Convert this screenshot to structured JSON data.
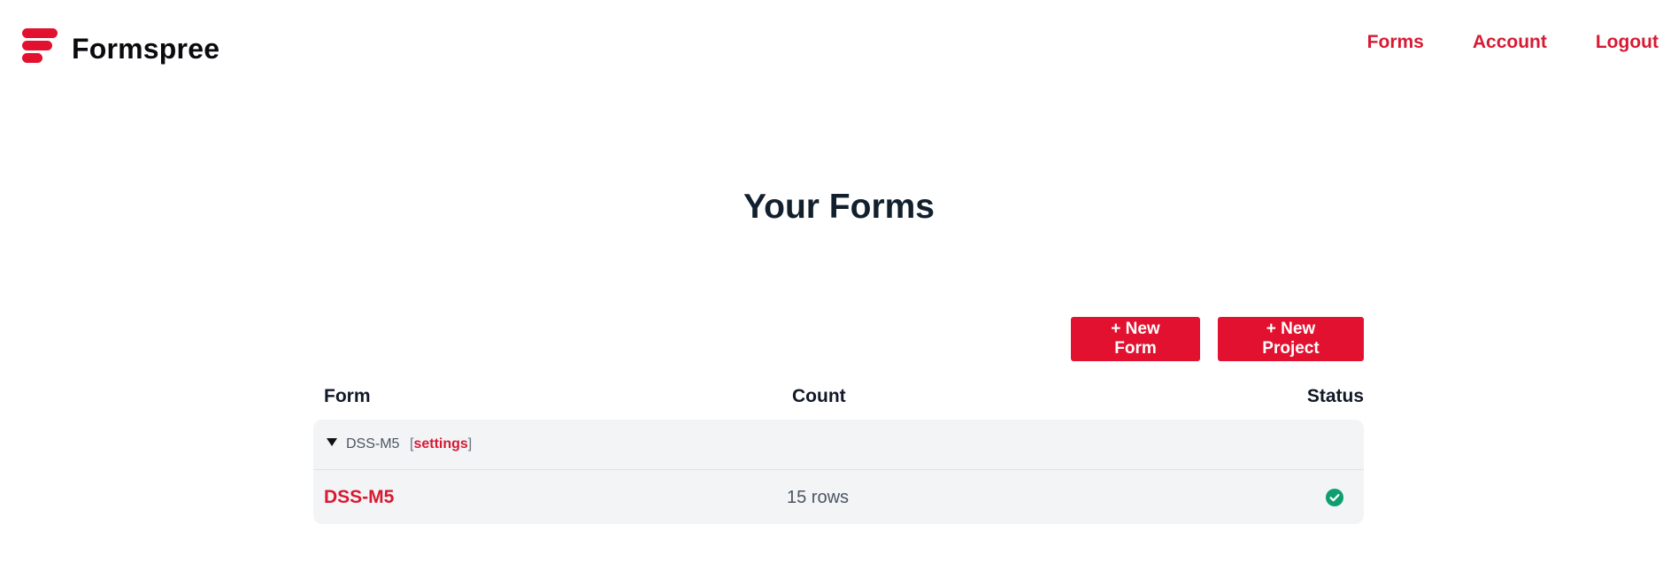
{
  "brand": {
    "name": "Formspree",
    "color": "#e1112f"
  },
  "nav": {
    "forms": "Forms",
    "account": "Account",
    "logout": "Logout"
  },
  "page": {
    "title": "Your Forms"
  },
  "actions": {
    "new_form": "+ New Form",
    "new_project": "+ New Project"
  },
  "table": {
    "headers": {
      "form": "Form",
      "count": "Count",
      "status": "Status"
    },
    "project": {
      "name": "DSS-M5",
      "settings_open": "[",
      "settings_label": "settings",
      "settings_close": "]",
      "expanded": true
    },
    "rows": [
      {
        "name": "DSS-M5",
        "count": "15 rows",
        "status_icon": "check-circle-icon",
        "status_color": "#0e9f6e"
      }
    ]
  }
}
